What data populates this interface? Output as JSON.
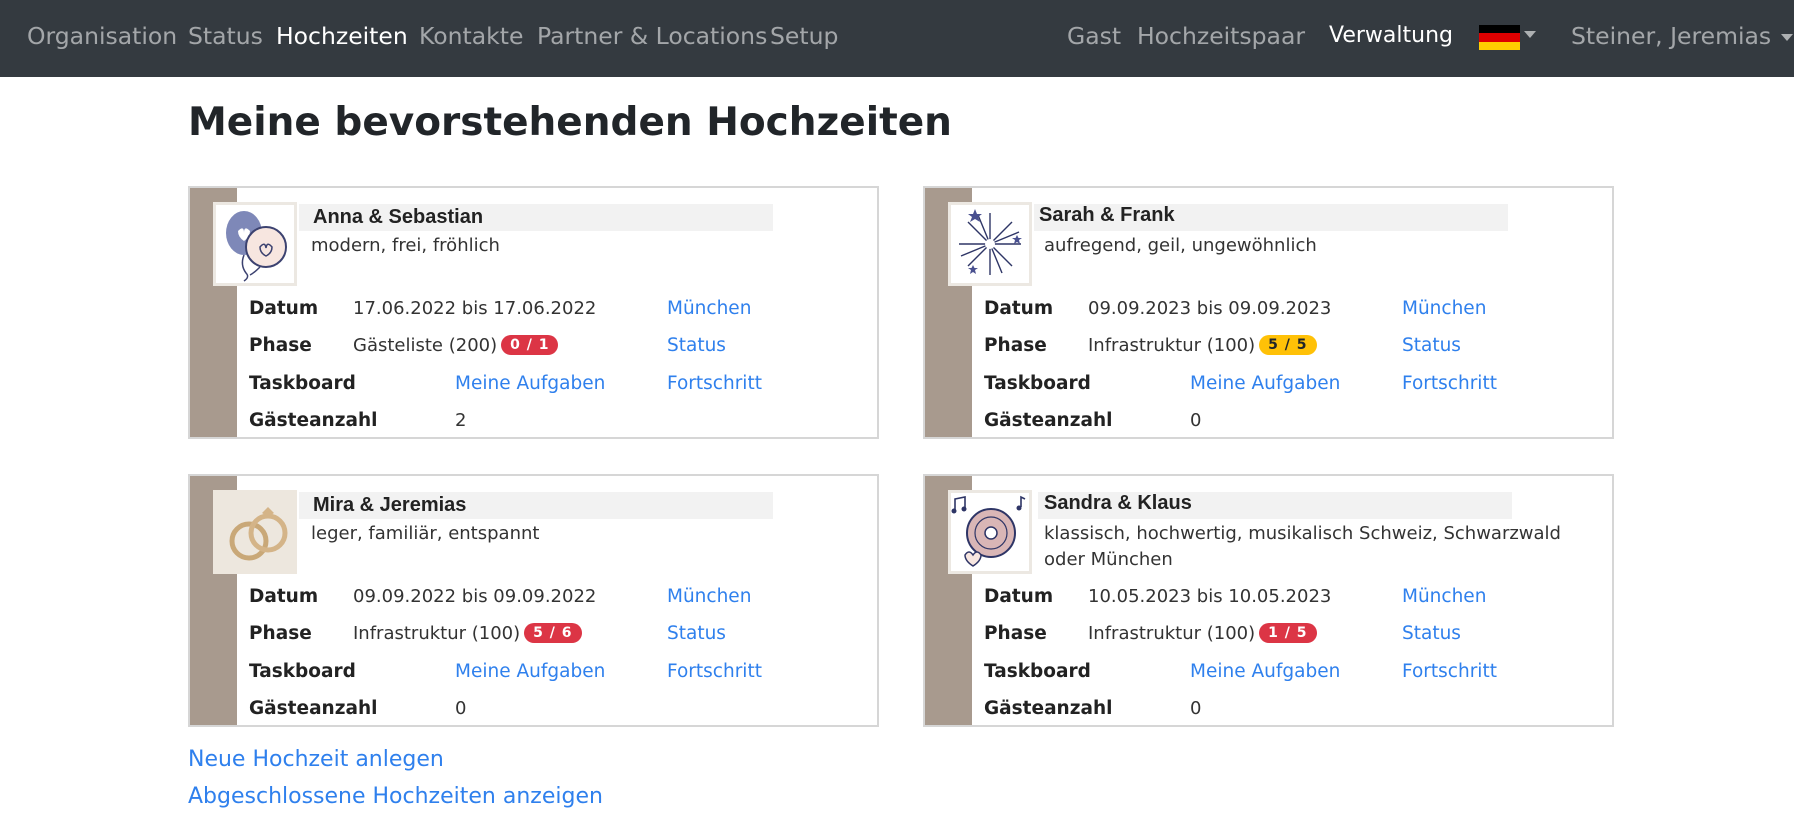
{
  "nav": {
    "left": [
      "Organisation",
      "Status",
      "Hochzeiten",
      "Kontakte",
      "Partner & Locations",
      "Setup"
    ],
    "right": {
      "guest": "Gast",
      "couple": "Hochzeitspaar",
      "admin": "Verwaltung",
      "user": "Steiner, Jeremias"
    },
    "active": "Hochzeiten"
  },
  "page": {
    "title": "Meine bevorstehenden Hochzeiten"
  },
  "labels": {
    "date": "Datum",
    "phase": "Phase",
    "taskboard": "Taskboard",
    "guests": "Gästeanzahl"
  },
  "weddings": [
    {
      "name": "Anna & Sebastian",
      "tags": "modern, frei, fröhlich",
      "date": "17.06.2022 bis 17.06.2022",
      "location": "München",
      "phase": "Gästeliste (200)",
      "badge": "0 / 1",
      "badge_color": "#dc3545",
      "status_link": "Status",
      "tasks_link": "Meine Aufgaben",
      "progress_link": "Fortschritt",
      "guest_count": "2",
      "icon": "balloons-icon"
    },
    {
      "name": "Sarah & Frank",
      "tags": "aufregend, geil, ungewöhnlich",
      "date": "09.09.2023 bis 09.09.2023",
      "location": "München",
      "phase": "Infrastruktur (100)",
      "badge": "5 / 5",
      "badge_color": "#ffc107",
      "status_link": "Status",
      "tasks_link": "Meine Aufgaben",
      "progress_link": "Fortschritt",
      "guest_count": "0",
      "icon": "fireworks-icon"
    },
    {
      "name": "Mira & Jeremias",
      "tags": "leger, familiär, entspannt",
      "date": "09.09.2022 bis 09.09.2022",
      "location": "München",
      "phase": "Infrastruktur (100)",
      "badge": "5 / 6",
      "badge_color": "#dc3545",
      "status_link": "Status",
      "tasks_link": "Meine Aufgaben",
      "progress_link": "Fortschritt",
      "guest_count": "0",
      "icon": "rings-icon"
    },
    {
      "name": "Sandra & Klaus",
      "tags": "klassisch, hochwertig, musikalisch Schweiz, Schwarzwald oder München",
      "date": "10.05.2023 bis 10.05.2023",
      "location": "München",
      "phase": "Infrastruktur (100)",
      "badge": "1 / 5",
      "badge_color": "#dc3545",
      "status_link": "Status",
      "tasks_link": "Meine Aufgaben",
      "progress_link": "Fortschritt",
      "guest_count": "0",
      "icon": "vinyl-record-icon"
    }
  ],
  "actions": {
    "new_wedding": "Neue Hochzeit anlegen",
    "show_completed": "Abgeschlossene Hochzeiten anzeigen"
  },
  "colors": {
    "navbar": "#343a40",
    "stripe": "#a89a8e",
    "link": "#2f80ed",
    "badge_red": "#dc3545",
    "badge_yellow": "#ffc107"
  }
}
